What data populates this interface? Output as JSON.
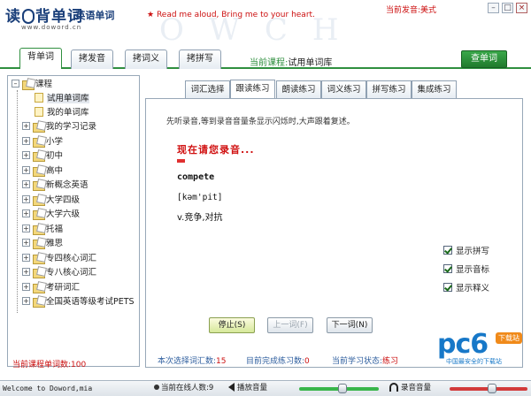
{
  "header": {
    "logo_text_left": "读",
    "logo_text_right": "背单词",
    "logo_subtitle": "– 英语单词",
    "logo_url": "www.doword.cn",
    "slogan_star": "★",
    "slogan": "Read me aloud, Bring me to your heart.",
    "watermark": "OWCH",
    "current_voice": "当前发音:美式"
  },
  "window_controls": {
    "minimize": "–",
    "maximize": "□",
    "close": "×"
  },
  "main_tabs": [
    {
      "label": "背单词",
      "active": true
    },
    {
      "label": "拷发音",
      "active": false
    },
    {
      "label": "拷词义",
      "active": false
    },
    {
      "label": "拷拼写",
      "active": false
    }
  ],
  "current_course": {
    "label": "当前课程:",
    "value": "试用单词库"
  },
  "lookup_button": "查单词",
  "tree": {
    "root": {
      "toggle": "–",
      "label": "课程"
    },
    "items": [
      {
        "label": "试用单词库",
        "toggle": "",
        "icon": "doc-icon",
        "selected": true
      },
      {
        "label": "我的单词库",
        "toggle": "",
        "icon": "doc-icon",
        "selected": false
      },
      {
        "label": "我的学习记录",
        "toggle": "+",
        "icon": "folder-icon",
        "selected": false
      },
      {
        "label": "小学",
        "toggle": "+",
        "icon": "folder-icon",
        "selected": false
      },
      {
        "label": "初中",
        "toggle": "+",
        "icon": "folder-icon",
        "selected": false
      },
      {
        "label": "高中",
        "toggle": "+",
        "icon": "folder-icon",
        "selected": false
      },
      {
        "label": "新概念英语",
        "toggle": "+",
        "icon": "folder-icon",
        "selected": false
      },
      {
        "label": "大学四级",
        "toggle": "+",
        "icon": "folder-icon",
        "selected": false
      },
      {
        "label": "大学六级",
        "toggle": "+",
        "icon": "folder-icon",
        "selected": false
      },
      {
        "label": "托福",
        "toggle": "+",
        "icon": "folder-icon",
        "selected": false
      },
      {
        "label": "雅思",
        "toggle": "+",
        "icon": "folder-icon",
        "selected": false
      },
      {
        "label": "专四核心词汇",
        "toggle": "+",
        "icon": "folder-icon",
        "selected": false
      },
      {
        "label": "专八核心词汇",
        "toggle": "+",
        "icon": "folder-icon",
        "selected": false
      },
      {
        "label": "考研词汇",
        "toggle": "+",
        "icon": "folder-icon",
        "selected": false
      },
      {
        "label": "全国英语等级考试PETS",
        "toggle": "+",
        "icon": "folder-icon",
        "selected": false
      }
    ],
    "footer": "当前课程单词数:100"
  },
  "sub_tabs": [
    {
      "label": "词汇选择",
      "active": false
    },
    {
      "label": "跟读练习",
      "active": true
    },
    {
      "label": "朗读练习",
      "active": false
    },
    {
      "label": "词义练习",
      "active": false
    },
    {
      "label": "拼写练习",
      "active": false
    },
    {
      "label": "集成练习",
      "active": false
    }
  ],
  "practice": {
    "instruction": "先听录音,等到录音音量条显示闪烁时,大声跟着复述。",
    "prompt": "现在请您录音...",
    "word": "compete",
    "phonetic": "[kəm'pit]",
    "meaning": "v.竞争,对抗"
  },
  "options": [
    {
      "label": "显示拼写",
      "checked": true
    },
    {
      "label": "显示音标",
      "checked": true
    },
    {
      "label": "显示释义",
      "checked": true
    }
  ],
  "buttons": {
    "stop": "停止(S)",
    "prev": "上一词(F)",
    "next": "下一词(N)"
  },
  "status": {
    "selected_label": "本次选择词汇数:",
    "selected_value": "15",
    "done_label": "目前完成练习数:",
    "done_value": "0",
    "state_label": "当前学习状态:",
    "state_value": "练习"
  },
  "brand": {
    "main": "pc6",
    "tag": "下载站",
    "sub": "中国最安全的下载站"
  },
  "statusbar": {
    "welcome": "Welcome to Doword,mia",
    "online": "当前在线人数:9",
    "playback_volume": "播放音量",
    "record_volume": "录音音量",
    "playback_level": 0.55,
    "record_level": 0.55
  },
  "colors": {
    "accent_green": "#2f8f3f",
    "alert_red": "#cc1010",
    "link_blue": "#2f5f9f",
    "brand_blue": "#1778c8"
  }
}
